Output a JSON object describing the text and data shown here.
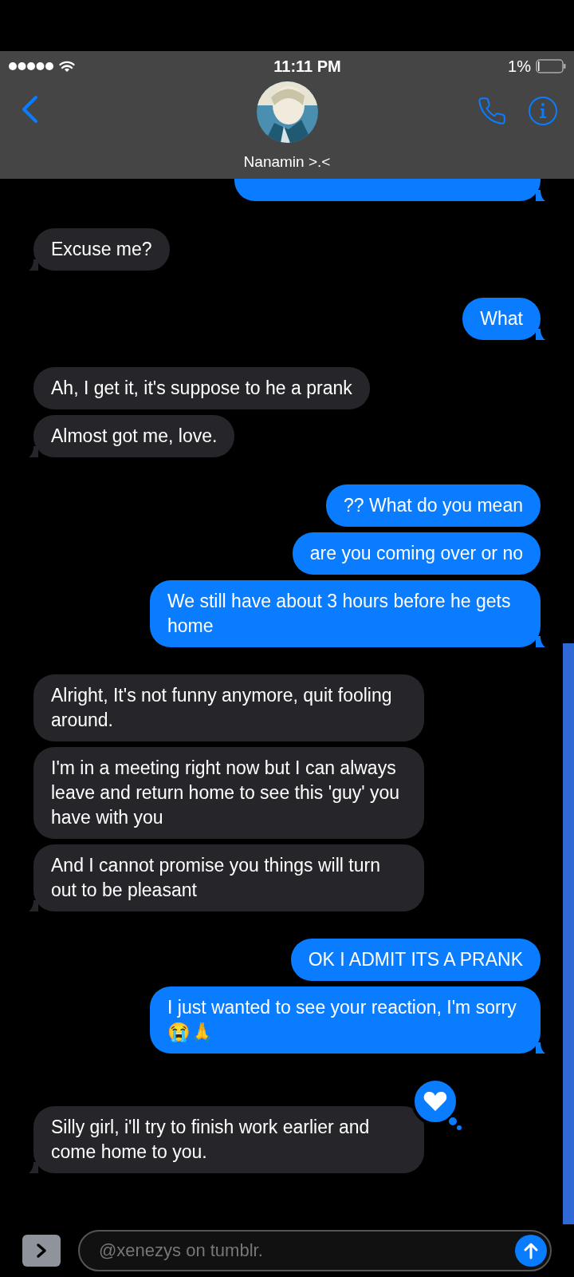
{
  "status_bar": {
    "time": "11:11 PM",
    "battery": "1%"
  },
  "contact": {
    "name": "Nanamin >.<"
  },
  "groups": [
    {
      "kind": "outgoing",
      "messages": [
        {
          "clipped": true
        }
      ]
    },
    {
      "kind": "incoming",
      "messages": [
        {
          "text": "Excuse me?"
        }
      ]
    },
    {
      "kind": "outgoing",
      "messages": [
        {
          "text": "What"
        }
      ]
    },
    {
      "kind": "incoming",
      "messages": [
        {
          "text": "Ah, I get it, it's suppose to he a prank"
        },
        {
          "text": "Almost got me, love."
        }
      ]
    },
    {
      "kind": "outgoing",
      "messages": [
        {
          "text": "?? What do you mean"
        },
        {
          "text": "are you coming over or no"
        },
        {
          "text": "We still have about 3 hours before he gets home"
        }
      ]
    },
    {
      "kind": "incoming",
      "messages": [
        {
          "text": "Alright, It's not funny anymore, quit fooling around."
        },
        {
          "text": "I'm in a meeting right now but I can always leave and return home to see this 'guy' you have with you"
        },
        {
          "text": "And I cannot promise you things will turn out to be pleasant"
        }
      ]
    },
    {
      "kind": "outgoing",
      "messages": [
        {
          "text": "OK I ADMIT ITS A PRANK"
        },
        {
          "text": "I just wanted to see your reaction, I'm sorry😭🙏"
        }
      ]
    },
    {
      "kind": "incoming",
      "messages": [
        {
          "text": "Silly girl, i'll try to finish work earlier and come home to you.",
          "hearted": true
        }
      ]
    }
  ],
  "composer": {
    "placeholder": "@xenezys on tumblr."
  }
}
